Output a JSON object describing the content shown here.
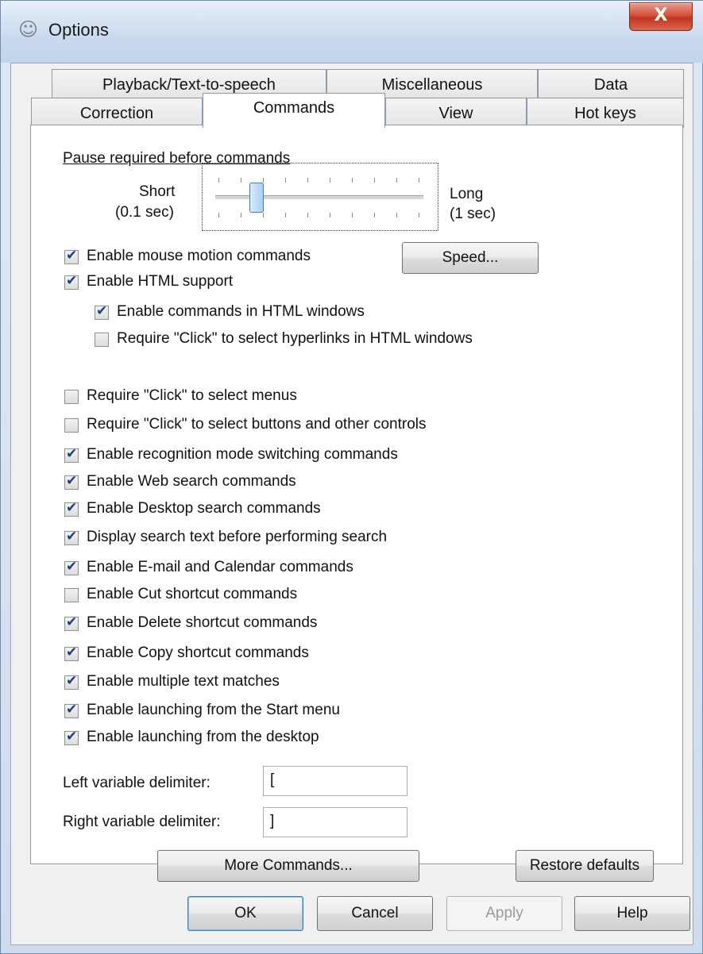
{
  "window": {
    "title": "Options",
    "close_label": "X",
    "icon": "speech-app-icon"
  },
  "tabs_row1": [
    "Playback/Text-to-speech",
    "Miscellaneous",
    "Data"
  ],
  "tabs_row2": [
    "Correction",
    "Commands",
    "View",
    "Hot keys"
  ],
  "active_tab": "Commands",
  "slider": {
    "label": "Pause required before commands",
    "min_label_1": "Short",
    "min_label_2": "(0.1 sec)",
    "max_label_1": "Long",
    "max_label_2": "(1 sec)",
    "value_fraction": 0.2
  },
  "speed_button": "Speed...",
  "checkboxes": [
    {
      "label": "Enable mouse motion commands",
      "checked": true
    },
    {
      "label": "Enable HTML support",
      "checked": true
    },
    {
      "label": "Enable commands in HTML windows",
      "checked": true
    },
    {
      "label": "Require \"Click\" to select hyperlinks in HTML windows",
      "checked": false
    },
    {
      "label": "Require \"Click\" to select menus",
      "checked": false
    },
    {
      "label": "Require \"Click\" to select buttons and other controls",
      "checked": false
    },
    {
      "label": "Enable recognition mode switching commands",
      "checked": true
    },
    {
      "label": "Enable Web search commands",
      "checked": true
    },
    {
      "label": "Enable Desktop search commands",
      "checked": true
    },
    {
      "label": "Display search text before performing search",
      "checked": true
    },
    {
      "label": "Enable E-mail and Calendar commands",
      "checked": true
    },
    {
      "label": "Enable Cut shortcut commands",
      "checked": false
    },
    {
      "label": "Enable Delete shortcut commands",
      "checked": true
    },
    {
      "label": "Enable Copy shortcut commands",
      "checked": true
    },
    {
      "label": "Enable multiple text matches",
      "checked": true
    },
    {
      "label": "Enable launching from the Start menu",
      "checked": true
    },
    {
      "label": "Enable launching from the desktop",
      "checked": true
    }
  ],
  "delimiters": {
    "left_label": "Left variable delimiter:",
    "left_value": "[",
    "right_label": "Right variable delimiter:",
    "right_value": "]"
  },
  "buttons": {
    "more_commands": "More Commands...",
    "restore_defaults": "Restore defaults",
    "ok": "OK",
    "cancel": "Cancel",
    "apply": "Apply",
    "help": "Help"
  }
}
